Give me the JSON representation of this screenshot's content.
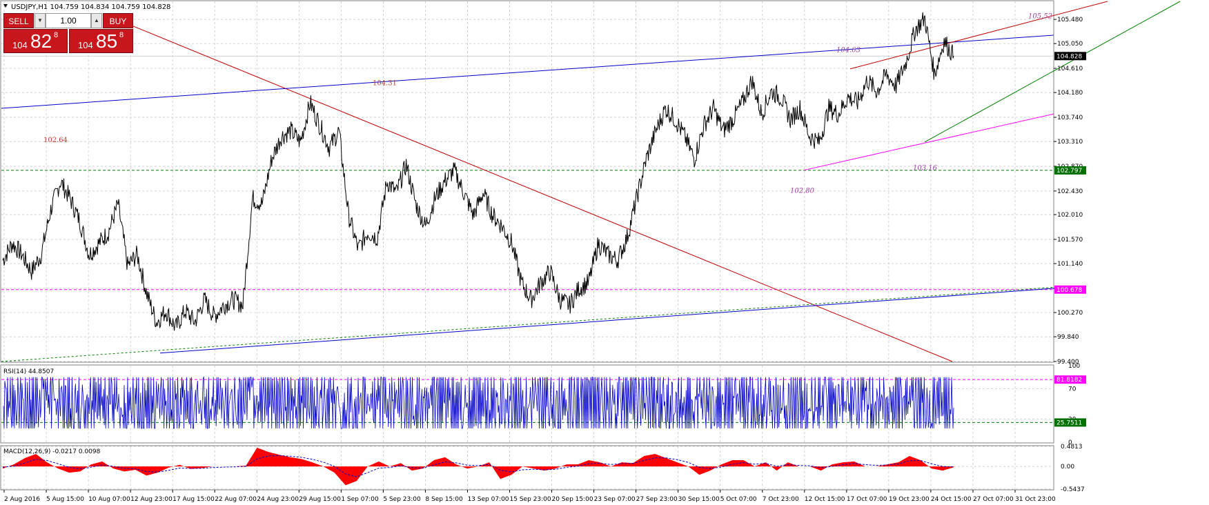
{
  "window": {
    "arrow_icon": "triangle-down-icon",
    "header_text": "USDJPY,H1  104.759 104.834 104.759 104.828"
  },
  "trade_panel": {
    "sell_label": "SELL",
    "buy_label": "BUY",
    "lot_value": "1.00",
    "spin_down_icon": "chevron-down-icon",
    "spin_up_icon": "chevron-up-icon",
    "sell_price": {
      "small": "104",
      "big": "82",
      "sup": "8"
    },
    "buy_price": {
      "small": "104",
      "big": "85",
      "sup": "8"
    }
  },
  "colors": {
    "price": "#000000",
    "grid": "#c0c0c0",
    "trend_red": "#c00000",
    "trend_blue": "#0000c8",
    "trend_green": "#008000",
    "trend_magenta": "#ff00ff",
    "annotation_red": "#c0392b",
    "annotation_purple": "#9b3fa3",
    "rsi": "#0000c8",
    "macd_hist": "#ff0000",
    "current_price_bg": "#000000",
    "level_green_bg": "#007000",
    "level_magenta_bg": "#ff00ff"
  },
  "chart_data": [
    {
      "type": "line",
      "panel": "price",
      "symbol": "USDJPY",
      "timeframe": "H1",
      "ylim": [
        99.4,
        105.8
      ],
      "yticks": [
        "105.480",
        "105.050",
        "104.610",
        "104.180",
        "103.740",
        "103.310",
        "102.870",
        "102.430",
        "102.010",
        "101.570",
        "101.140",
        "100.700",
        "100.270",
        "99.840",
        "99.400"
      ],
      "xticks": [
        "2 Aug 2016",
        "5 Aug 15:00",
        "10 Aug 07:00",
        "12 Aug 23:00",
        "17 Aug 15:00",
        "22 Aug 07:00",
        "24 Aug 23:00",
        "29 Aug 15:00",
        "1 Sep 07:00",
        "5 Sep 23:00",
        "8 Sep 15:00",
        "13 Sep 07:00",
        "15 Sep 23:00",
        "20 Sep 15:00",
        "23 Sep 07:00",
        "27 Sep 23:00",
        "30 Sep 15:00",
        "5 Oct 07:00",
        "7 Oct 23:00",
        "12 Oct 15:00",
        "17 Oct 07:00",
        "19 Oct 23:00",
        "24 Oct 15:00",
        "27 Oct 07:00",
        "31 Oct 23:00"
      ],
      "grid": true,
      "close_anchor": [
        {
          "t": 0,
          "v": 101.2
        },
        {
          "t": 1,
          "v": 101.5
        },
        {
          "t": 2,
          "v": 101.3
        },
        {
          "t": 3,
          "v": 101.0
        },
        {
          "t": 4,
          "v": 101.3
        },
        {
          "t": 5,
          "v": 102.1
        },
        {
          "t": 6,
          "v": 102.6
        },
        {
          "t": 7,
          "v": 102.3
        },
        {
          "t": 8,
          "v": 101.9
        },
        {
          "t": 9,
          "v": 101.3
        },
        {
          "t": 10,
          "v": 101.5
        },
        {
          "t": 11,
          "v": 101.7
        },
        {
          "t": 12,
          "v": 102.2
        },
        {
          "t": 13,
          "v": 101.1
        },
        {
          "t": 14,
          "v": 101.3
        },
        {
          "t": 15,
          "v": 100.6
        },
        {
          "t": 16,
          "v": 100.1
        },
        {
          "t": 17,
          "v": 100.3
        },
        {
          "t": 18,
          "v": 100.0
        },
        {
          "t": 19,
          "v": 100.3
        },
        {
          "t": 20,
          "v": 100.1
        },
        {
          "t": 21,
          "v": 100.5
        },
        {
          "t": 22,
          "v": 100.2
        },
        {
          "t": 23,
          "v": 100.4
        },
        {
          "t": 24,
          "v": 100.5
        },
        {
          "t": 25,
          "v": 100.4
        },
        {
          "t": 26,
          "v": 102.3
        },
        {
          "t": 27,
          "v": 102.2
        },
        {
          "t": 28,
          "v": 103.0
        },
        {
          "t": 29,
          "v": 103.4
        },
        {
          "t": 30,
          "v": 103.5
        },
        {
          "t": 31,
          "v": 103.3
        },
        {
          "t": 32,
          "v": 104.0
        },
        {
          "t": 33,
          "v": 103.6
        },
        {
          "t": 34,
          "v": 103.2
        },
        {
          "t": 35,
          "v": 103.5
        },
        {
          "t": 36,
          "v": 102.0
        },
        {
          "t": 37,
          "v": 101.4
        },
        {
          "t": 38,
          "v": 101.7
        },
        {
          "t": 39,
          "v": 101.6
        },
        {
          "t": 40,
          "v": 102.6
        },
        {
          "t": 41,
          "v": 102.4
        },
        {
          "t": 42,
          "v": 102.9
        },
        {
          "t": 43,
          "v": 102.2
        },
        {
          "t": 44,
          "v": 101.8
        },
        {
          "t": 45,
          "v": 102.3
        },
        {
          "t": 46,
          "v": 102.6
        },
        {
          "t": 47,
          "v": 102.8
        },
        {
          "t": 48,
          "v": 102.4
        },
        {
          "t": 49,
          "v": 102.0
        },
        {
          "t": 50,
          "v": 102.4
        },
        {
          "t": 51,
          "v": 102.0
        },
        {
          "t": 52,
          "v": 101.8
        },
        {
          "t": 53,
          "v": 101.5
        },
        {
          "t": 54,
          "v": 100.8
        },
        {
          "t": 55,
          "v": 100.5
        },
        {
          "t": 56,
          "v": 100.8
        },
        {
          "t": 57,
          "v": 101.0
        },
        {
          "t": 58,
          "v": 100.5
        },
        {
          "t": 59,
          "v": 100.4
        },
        {
          "t": 60,
          "v": 100.7
        },
        {
          "t": 61,
          "v": 100.8
        },
        {
          "t": 62,
          "v": 101.5
        },
        {
          "t": 63,
          "v": 101.3
        },
        {
          "t": 64,
          "v": 101.2
        },
        {
          "t": 65,
          "v": 101.6
        },
        {
          "t": 66,
          "v": 102.3
        },
        {
          "t": 67,
          "v": 103.0
        },
        {
          "t": 68,
          "v": 103.5
        },
        {
          "t": 69,
          "v": 103.9
        },
        {
          "t": 70,
          "v": 103.7
        },
        {
          "t": 71,
          "v": 103.4
        },
        {
          "t": 72,
          "v": 103.0
        },
        {
          "t": 73,
          "v": 103.6
        },
        {
          "t": 74,
          "v": 103.9
        },
        {
          "t": 75,
          "v": 103.5
        },
        {
          "t": 76,
          "v": 103.7
        },
        {
          "t": 77,
          "v": 104.0
        },
        {
          "t": 78,
          "v": 104.4
        },
        {
          "t": 79,
          "v": 103.8
        },
        {
          "t": 80,
          "v": 104.2
        },
        {
          "t": 81,
          "v": 104.1
        },
        {
          "t": 82,
          "v": 103.7
        },
        {
          "t": 83,
          "v": 103.9
        },
        {
          "t": 84,
          "v": 103.4
        },
        {
          "t": 85,
          "v": 103.3
        },
        {
          "t": 86,
          "v": 103.9
        },
        {
          "t": 87,
          "v": 103.8
        },
        {
          "t": 88,
          "v": 104.1
        },
        {
          "t": 89,
          "v": 104.0
        },
        {
          "t": 90,
          "v": 104.4
        },
        {
          "t": 91,
          "v": 104.2
        },
        {
          "t": 92,
          "v": 104.5
        },
        {
          "t": 93,
          "v": 104.3
        },
        {
          "t": 94,
          "v": 104.7
        },
        {
          "t": 95,
          "v": 105.3
        },
        {
          "t": 96,
          "v": 105.5
        },
        {
          "t": 97,
          "v": 104.5
        },
        {
          "t": 98,
          "v": 105.1
        },
        {
          "t": 99,
          "v": 104.83
        }
      ],
      "levels": [
        {
          "label": "102.797",
          "value": 102.797,
          "style": "green-dashed"
        },
        {
          "label": "100.678",
          "value": 100.678,
          "style": "magenta-dashed"
        }
      ],
      "current_price": "104.828",
      "annotations": [
        {
          "text": "104.31",
          "color": "red"
        },
        {
          "text": "102.64",
          "color": "red"
        },
        {
          "text": "104.63",
          "color": "purple"
        },
        {
          "text": "105.52",
          "color": "purple"
        },
        {
          "text": "103.16",
          "color": "purple"
        },
        {
          "text": "102.80",
          "color": "purple"
        }
      ]
    },
    {
      "type": "line",
      "panel": "rsi",
      "title": "RSI(14) 44.8507",
      "ylim": [
        0,
        100
      ],
      "yticks": [
        "100",
        "70",
        "30",
        "0"
      ],
      "levels": [
        {
          "label": "81.8182",
          "value": 81.8182,
          "style": "magenta-dashed"
        },
        {
          "label": "25.7511",
          "value": 25.7511,
          "style": "green-dashed"
        }
      ],
      "last": 44.8507
    },
    {
      "type": "area",
      "panel": "macd",
      "title": "MACD(12,26,9) -0.0217 0.0098",
      "ylim": [
        -0.5437,
        0.4813
      ],
      "yticks": [
        "0.4813",
        "0.00",
        "-0.5437"
      ],
      "values": [
        -0.05,
        0.05,
        0.2,
        0.3,
        0.1,
        -0.05,
        -0.15,
        -0.12,
        0.05,
        0.12,
        -0.05,
        -0.12,
        -0.08,
        -0.22,
        -0.15,
        -0.03,
        0.04,
        -0.06,
        -0.04,
        0.0,
        0.0,
        0.0,
        0.02,
        0.45,
        0.35,
        0.28,
        0.22,
        0.18,
        0.1,
        0.0,
        -0.15,
        -0.45,
        -0.35,
        0.0,
        0.12,
        0.0,
        0.08,
        -0.1,
        -0.05,
        0.15,
        0.22,
        0.05,
        -0.05,
        0.0,
        0.1,
        -0.3,
        -0.2,
        0.0,
        -0.05,
        -0.1,
        -0.05,
        0.05,
        0.05,
        0.15,
        0.1,
        0.0,
        0.1,
        0.08,
        0.25,
        0.3,
        0.2,
        0.1,
        0.0,
        -0.2,
        -0.1,
        0.05,
        0.15,
        0.15,
        0.0,
        0.1,
        -0.1,
        0.1,
        0.0,
        0.0,
        -0.1,
        0.05,
        0.1,
        0.12,
        0.0,
        0.0,
        0.05,
        0.1,
        0.25,
        0.15,
        -0.05,
        -0.1,
        -0.02
      ]
    }
  ]
}
